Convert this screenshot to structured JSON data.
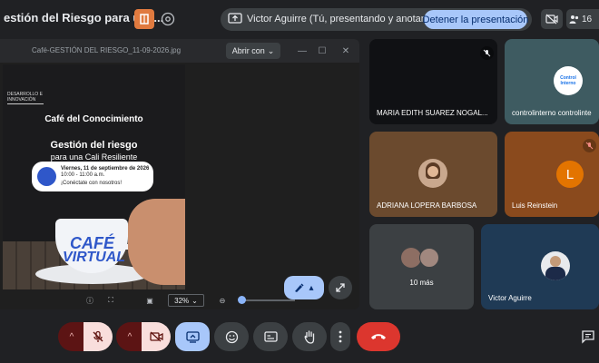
{
  "header": {
    "meeting_title": "estión del Riesgo para una...",
    "presenter_status": "Victor Aguirre (Tú, presentando y anotando)",
    "stop_presenting_label": "Detener la presentación",
    "participant_count": "16"
  },
  "viewer": {
    "filename": "Café-GESTIÓN DEL RIESGO_11-09-2026.jpg",
    "open_with_label": "Abrir con",
    "zoom_level": "32%"
  },
  "poster": {
    "brand_line1": "DESARROLLO E",
    "brand_line2": "INNOVACIÓN",
    "headline": "Café del Conocimiento",
    "title": "Gestión del riesgo",
    "subtitle": "para una Cali Resiliente",
    "date": "Viernes, 11 de septiembre de 2026",
    "time": "10:00 - 11:00 a.m.",
    "cta": "¡Conéctate con nosotros!",
    "cup_line1": "CAFÉ",
    "cup_line2": "VIRTUAL"
  },
  "participants": [
    {
      "name": "MARIA EDITH SUAREZ NOGAL...",
      "muted": true
    },
    {
      "name": "controlinterno controlinte",
      "logo_text": "Control Interno",
      "muted": false
    },
    {
      "name": "ADRIANA LOPERA BARBOSA",
      "muted": false
    },
    {
      "name": "Luis Reinstein",
      "initial": "L",
      "muted": true
    },
    {
      "name": "10 más",
      "muted": false
    },
    {
      "name": "Victor Aguirre",
      "muted": false
    }
  ],
  "colors": {
    "background": "#202124",
    "accent": "#a8c7fa",
    "danger": "#dc362e",
    "muted_bg": "#f9dedc",
    "avatar_orange": "#e37400"
  },
  "controls": [
    {
      "name": "microphone",
      "icon": "mic-off-icon",
      "state": "off"
    },
    {
      "name": "camera",
      "icon": "camera-off-icon",
      "state": "off"
    },
    {
      "name": "present",
      "icon": "present-screen-icon",
      "state": "on"
    },
    {
      "name": "reactions",
      "icon": "emoji-icon"
    },
    {
      "name": "captions",
      "icon": "captions-icon"
    },
    {
      "name": "raise-hand",
      "icon": "hand-icon"
    },
    {
      "name": "more",
      "icon": "more-vert-icon"
    },
    {
      "name": "leave-call",
      "icon": "call-end-icon"
    }
  ]
}
